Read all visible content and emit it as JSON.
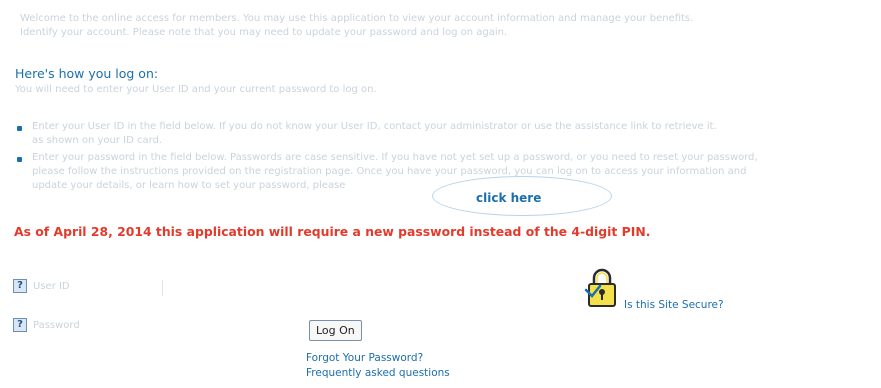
{
  "intro": {
    "line1": "Welcome to the online access for members. You may use this application to view your account information and manage your benefits.",
    "line2": "Identify your account. Please note that you may need to update your password and log on again."
  },
  "logon_help": {
    "heading": "Here's how you log on:",
    "subheading": "You will need to enter your User ID and your current password to log on."
  },
  "bullets": [
    {
      "line1": "Enter your User ID in the field below. If you do not know your User ID, contact your administrator or use the assistance link to retrieve it.",
      "line2": "as shown on your ID card."
    },
    {
      "line1": "Enter your password in the field below. Passwords are case sensitive. If you have not yet set up a password, or you need to reset your password,",
      "line2": "please follow the instructions provided on the registration page. Once you have your password, you can log on to access your information and",
      "line3": "update your details, or learn how to set your password, please"
    }
  ],
  "click_here": "click here",
  "warning": "As of April 28, 2014 this application will require a new password instead of the 4-digit PIN.",
  "form": {
    "help_glyph": "?",
    "user_label": "User ID",
    "password_label": "Password",
    "logon_button": "Log On",
    "forgot_password": "Forgot Your Password?",
    "faq": "Frequently asked questions"
  },
  "secure": {
    "link": "Is this Site Secure?",
    "icon": "padlock-icon"
  },
  "colors": {
    "link": "#1b6fae",
    "warning": "#e23b2c",
    "faint_text": "#c9d3dd"
  }
}
